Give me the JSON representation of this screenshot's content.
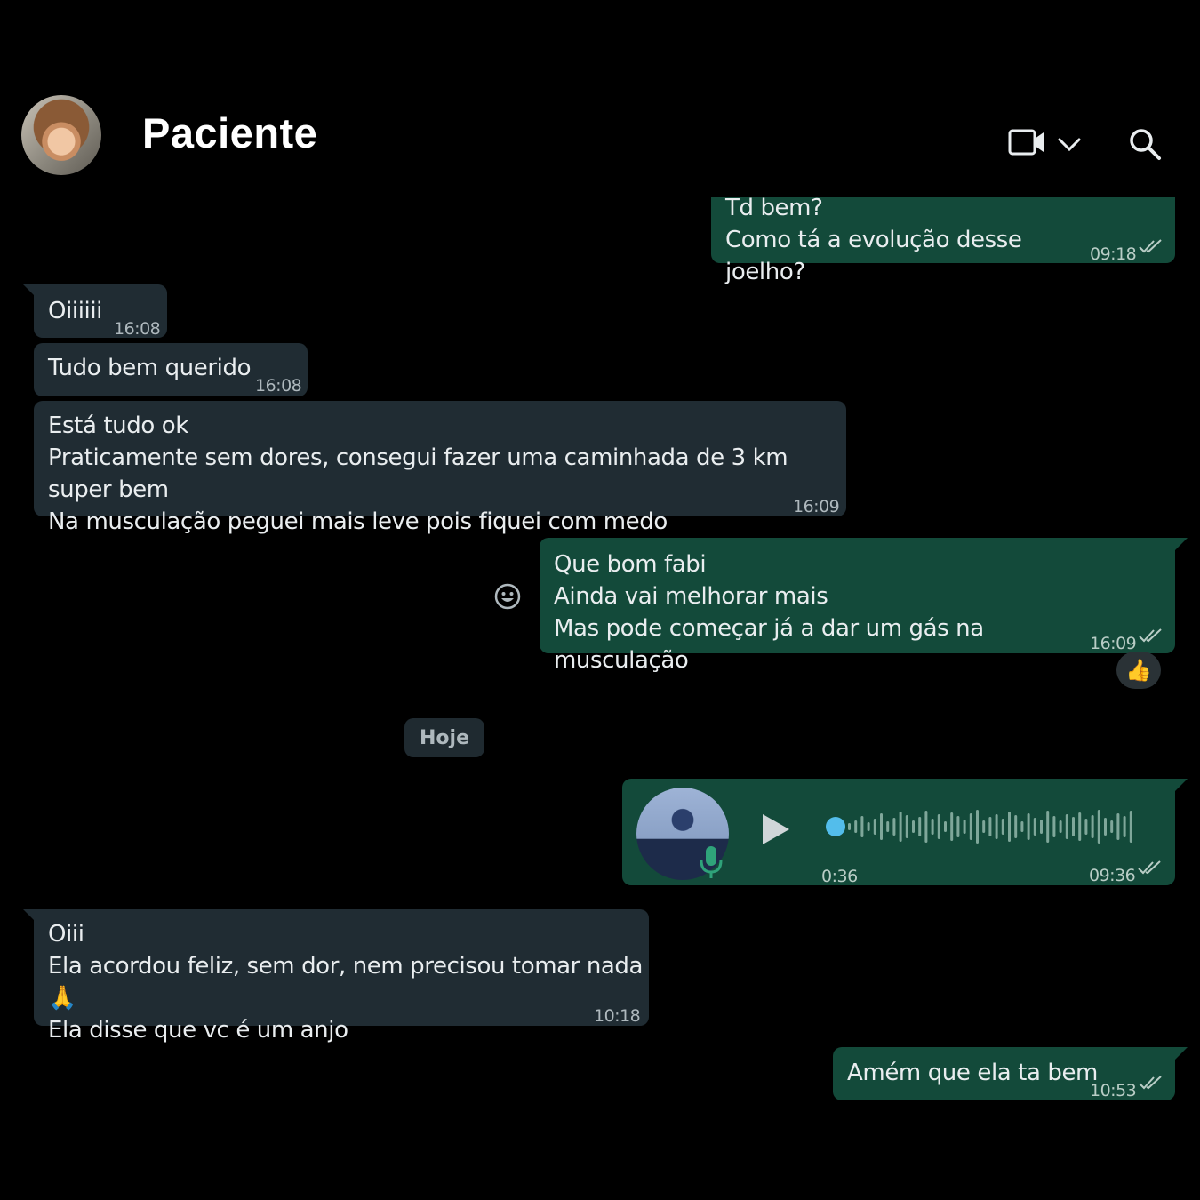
{
  "header": {
    "contact_name": "Paciente"
  },
  "messages": [
    {
      "dir": "out",
      "lines": "Td bem?\nComo tá a evolução desse joelho?",
      "time": "09:18"
    },
    {
      "dir": "in",
      "lines": "Oiiiiii",
      "time": "16:08"
    },
    {
      "dir": "in",
      "lines": "Tudo bem querido",
      "time": "16:08"
    },
    {
      "dir": "in",
      "lines": "Está tudo ok\nPraticamente sem dores, consegui fazer uma caminhada de 3 km super bem\nNa musculação peguei mais leve pois fiquei com medo",
      "time": "16:09"
    },
    {
      "dir": "out",
      "lines": "Que bom fabi\nAinda vai melhorar mais\nMas pode começar já a dar um gás na musculação",
      "time": "16:09",
      "reaction": "👍"
    },
    {
      "dir": "out",
      "type": "voice",
      "duration": "0:36",
      "time": "09:36"
    },
    {
      "dir": "in",
      "lines": "Oiii\nEla acordou feliz, sem dor, nem precisou tomar nada 🙏\nEla disse que vc é um anjo",
      "time": "10:18"
    },
    {
      "dir": "out",
      "lines": "Amém que ela ta bem",
      "time": "10:53"
    }
  ],
  "day_separator": "Hoje",
  "colors": {
    "incoming": "#202c33",
    "outgoing": "#134a3a",
    "accent": "#53bdeb"
  }
}
